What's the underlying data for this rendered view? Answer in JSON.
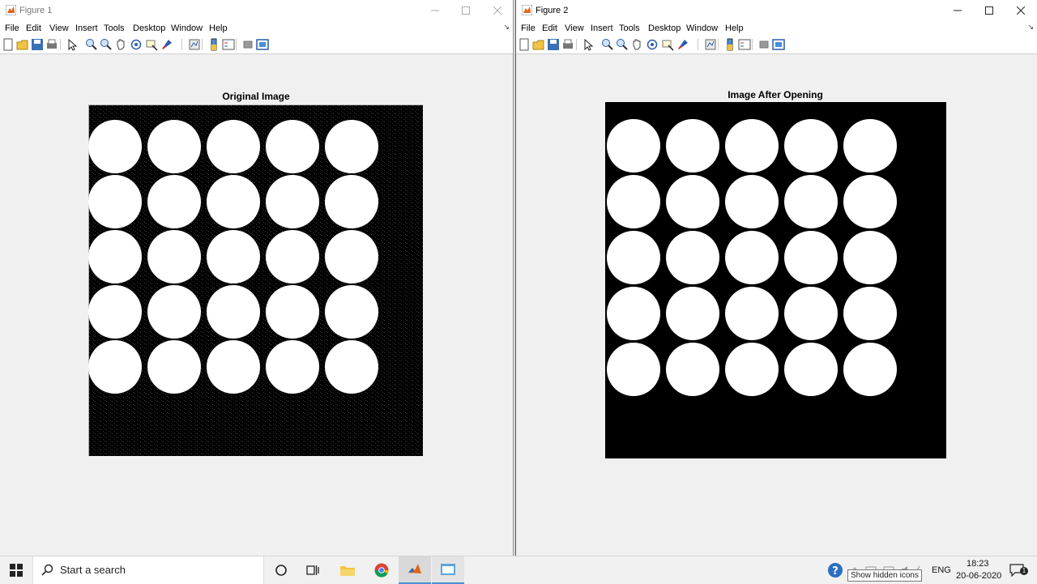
{
  "figure1": {
    "window_title": "Figure 1",
    "menu": [
      "File",
      "Edit",
      "View",
      "Insert",
      "Tools",
      "Desktop",
      "Window",
      "Help"
    ],
    "axes_title": "Original Image"
  },
  "figure2": {
    "window_title": "Figure 2",
    "menu": [
      "File",
      "Edit",
      "View",
      "Insert",
      "Tools",
      "Desktop",
      "Window",
      "Help"
    ],
    "axes_title": "Image After Opening"
  },
  "toolbar_icons": [
    "new-figure-icon",
    "open-file-icon",
    "save-icon",
    "print-icon",
    "edit-plot-icon",
    "zoom-in-icon",
    "zoom-out-icon",
    "pan-icon",
    "rotate-3d-icon",
    "data-cursor-icon",
    "brush-icon",
    "link-plot-icon",
    "insert-colorbar-icon",
    "insert-legend-icon",
    "hide-plot-tools-icon",
    "show-plot-tools-icon"
  ],
  "colors": {
    "window_bg": "#f0f0f0",
    "image_bg": "#000000",
    "blob": "#ffffff",
    "taskbar": "#f1f1f1"
  },
  "taskbar": {
    "search_placeholder": "Start a search",
    "language": "ENG",
    "time": "18:23",
    "date": "20-06-2020",
    "tooltip": "Show hidden icons",
    "notification_count": "1"
  }
}
